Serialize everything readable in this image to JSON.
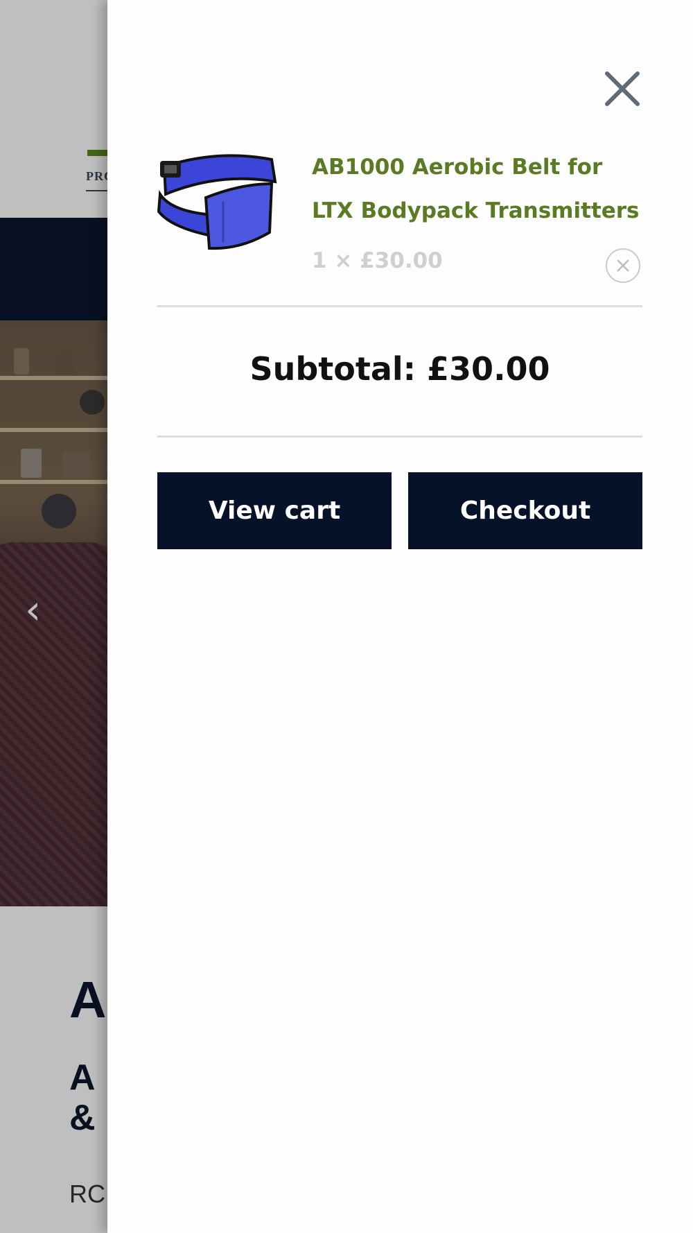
{
  "background_page": {
    "logo_text": "PRC",
    "hero_prev_arrow": "‹",
    "heading_1": "A",
    "heading_2_line1": "A",
    "heading_2_line2": "&",
    "paragraph_start": "RC"
  },
  "mini_cart": {
    "close_icon": "close-icon",
    "items": [
      {
        "title": "AB1000 Aerobic Belt for LTX Bodypack Transmitters",
        "quantity_price": "1 × £30.00",
        "remove_icon": "remove-circle-x-icon",
        "image": "aerobic-belt-blue"
      }
    ],
    "subtotal_label": "Subtotal:",
    "subtotal_value": "£30.00",
    "buttons": {
      "view_cart": "View cart",
      "checkout": "Checkout"
    }
  },
  "colors": {
    "product_title": "#5a7a23",
    "button_bg": "#061229",
    "navbar_bg": "#0b1730"
  }
}
